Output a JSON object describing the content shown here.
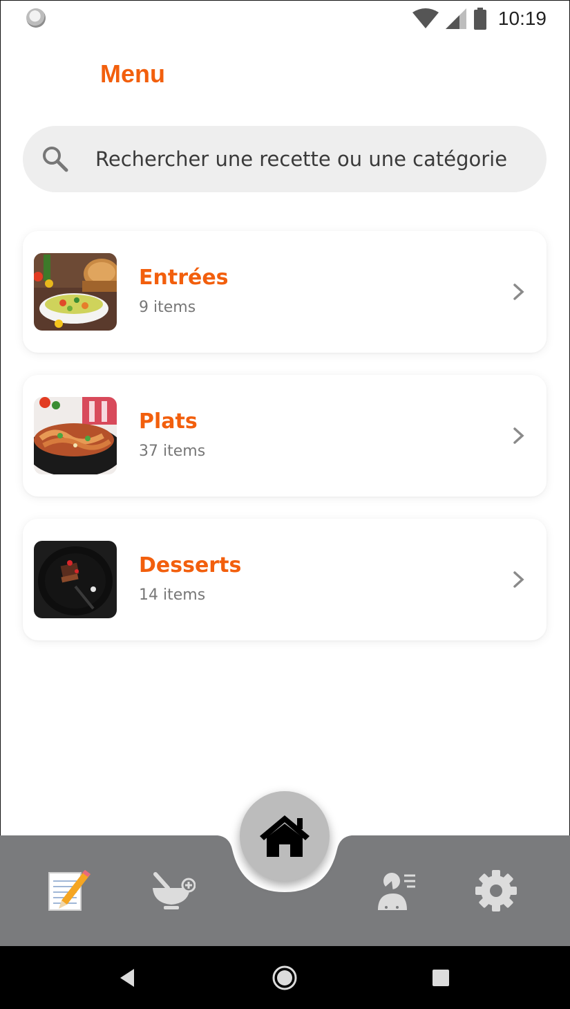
{
  "status_bar": {
    "time": "10:19"
  },
  "header": {
    "title": "Menu"
  },
  "search": {
    "placeholder": "Rechercher une recette ou une catégorie"
  },
  "categories": [
    {
      "title": "Entrées",
      "count": "9 items",
      "image": "salad-thumbnail"
    },
    {
      "title": "Plats",
      "count": "37 items",
      "image": "pasta-thumbnail"
    },
    {
      "title": "Desserts",
      "count": "14 items",
      "image": "dessert-thumbnail"
    }
  ],
  "bottom_nav": {
    "items": [
      "notepad-icon",
      "mortar-add-icon",
      "home-icon",
      "user-list-icon",
      "gear-icon"
    ],
    "active": "home-icon"
  },
  "colors": {
    "accent": "#f25f0d",
    "nav_bar": "#7a7b7d",
    "search_bg": "#eeeeee",
    "fab": "#bcbcbc"
  }
}
